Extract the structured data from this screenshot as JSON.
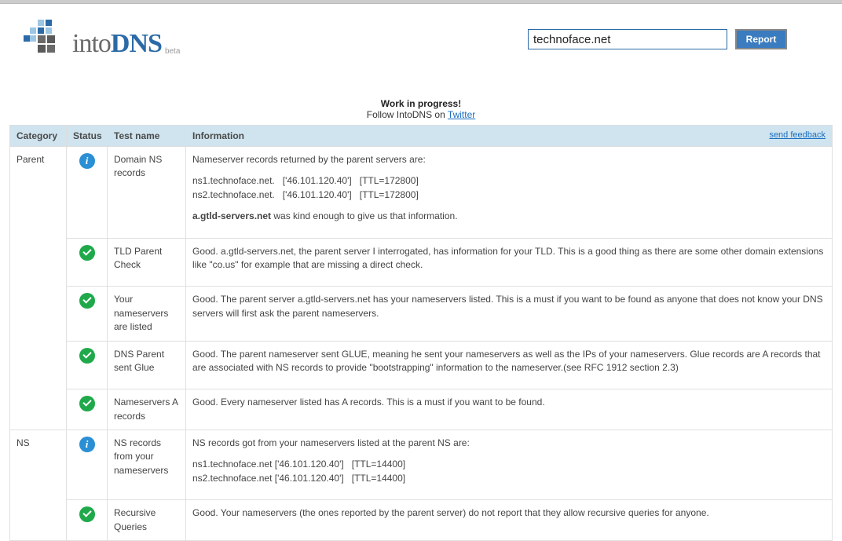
{
  "logo": {
    "text1": "into",
    "text2": "DNS",
    "beta": "beta"
  },
  "search": {
    "value": "technoface.net",
    "button": "Report"
  },
  "wip": {
    "bold": "Work in progress!",
    "prefix": "Follow IntoDNS on ",
    "link": "Twitter"
  },
  "headers": {
    "category": "Category",
    "status": "Status",
    "test": "Test name",
    "info": "Information",
    "feedback": "send feedback"
  },
  "groups": [
    {
      "category": "Parent",
      "rows": [
        {
          "status": "info",
          "test": "Domain NS records",
          "lines": [
            {
              "t": "Nameserver records returned by the parent servers are:"
            },
            {
              "t": "ns1.technoface.net.   ['46.101.120.40']   [TTL=172800]\nns2.technoface.net.   ['46.101.120.40']   [TTL=172800]",
              "mono": true
            },
            {
              "pre": "",
              "bold": "a.gtld-servers.net",
              "post": " was kind enough to give us that information."
            }
          ]
        },
        {
          "status": "ok",
          "test": "TLD Parent Check",
          "lines": [
            {
              "t": "Good. a.gtld-servers.net, the parent server I interrogated, has information for your TLD. This is a good thing as there are some other domain extensions like \"co.us\" for example that are missing a direct check."
            }
          ]
        },
        {
          "status": "ok",
          "test": "Your nameservers are listed",
          "lines": [
            {
              "t": "Good. The parent server a.gtld-servers.net has your nameservers listed. This is a must if you want to be found as anyone that does not know your DNS servers will first ask the parent nameservers."
            }
          ]
        },
        {
          "status": "ok",
          "test": "DNS Parent sent Glue",
          "lines": [
            {
              "t": "Good. The parent nameserver sent GLUE, meaning he sent your nameservers as well as the IPs of your nameservers. Glue records are A records that are associated with NS records to provide \"bootstrapping\" information to the nameserver.(see RFC 1912 section 2.3)"
            }
          ]
        },
        {
          "status": "ok",
          "test": "Nameservers A records",
          "lines": [
            {
              "t": "Good. Every nameserver listed has A records. This is a must if you want to be found."
            }
          ]
        }
      ]
    },
    {
      "category": "NS",
      "rows": [
        {
          "status": "info",
          "test": "NS records from your nameservers",
          "lines": [
            {
              "t": "NS records got from your nameservers listed at the parent NS are:"
            },
            {
              "t": "ns1.technoface.net ['46.101.120.40']   [TTL=14400]\nns2.technoface.net ['46.101.120.40']   [TTL=14400]",
              "mono": true
            }
          ]
        },
        {
          "status": "ok",
          "test": "Recursive Queries",
          "lines": [
            {
              "t": "Good. Your nameservers (the ones reported by the parent server) do not report that they allow recursive queries for anyone."
            }
          ]
        }
      ]
    }
  ]
}
